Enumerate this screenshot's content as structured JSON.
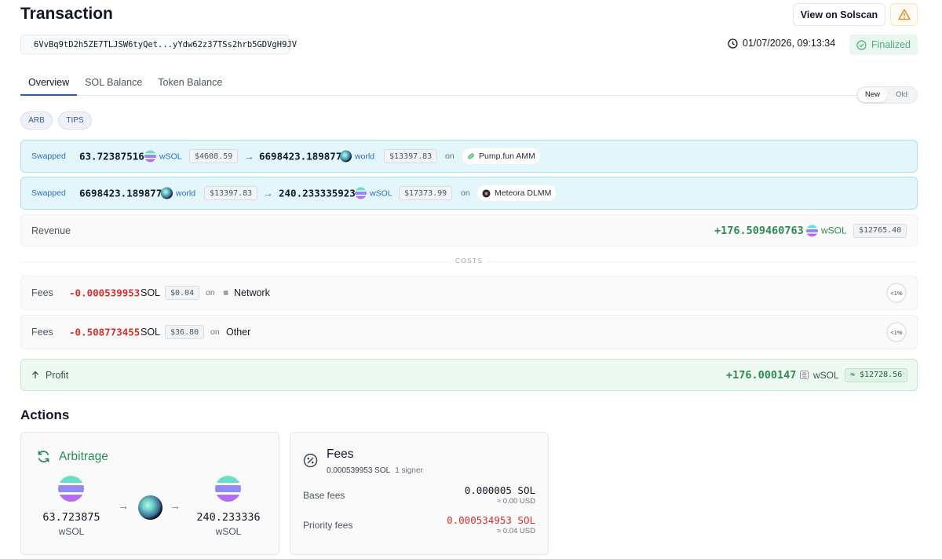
{
  "header": {
    "title": "Transaction",
    "view_button": "View on Solscan",
    "signature": "6VvBq9tD2h5ZE7TLJSW6tyQet...yYdw62z37TSs2hrb5GDVgH9JV",
    "timestamp": "01/07/2026, 09:13:34",
    "status": "Finalized"
  },
  "tabs": [
    "Overview",
    "SOL Balance",
    "Token Balance"
  ],
  "toggle": {
    "new": "New",
    "old": "Old"
  },
  "chips": [
    "ARB",
    "TIPS"
  ],
  "swaps": [
    {
      "label": "Swapped",
      "in_amount": "63.72387516",
      "in_token": "wSOL",
      "in_usd": "$4608.59",
      "arrow": "→",
      "out_amount": "6698423.189877",
      "out_token": "world",
      "out_usd": "$13397.83",
      "on": "on",
      "dex": "Pump.fun AMM"
    },
    {
      "label": "Swapped",
      "in_amount": "6698423.189877",
      "in_token": "world",
      "in_usd": "$13397.83",
      "arrow": "→",
      "out_amount": "240.233335923",
      "out_token": "wSOL",
      "out_usd": "$17373.99",
      "on": "on",
      "dex": "Meteora DLMM"
    }
  ],
  "revenue": {
    "label": "Revenue",
    "amount": "+176.509460763",
    "token": "wSOL",
    "usd": "$12765.40"
  },
  "costs_label": "COSTS",
  "fees": [
    {
      "label": "Fees",
      "amount": "-0.000539953",
      "token": "SOL",
      "usd": "$0.04",
      "on": "on",
      "target": "Network",
      "pct": "<1%"
    },
    {
      "label": "Fees",
      "amount": "-0.508773455",
      "token": "SOL",
      "usd": "$36.80",
      "on": "on",
      "target": "Other",
      "pct": "<1%"
    }
  ],
  "profit": {
    "label": "Profit",
    "amount": "+176.000147",
    "token": "wSOL",
    "usd": "≈ $12728.56"
  },
  "actions": {
    "title": "Actions",
    "arbitrage": {
      "title": "Arbitrage",
      "from_amount": "63.723875",
      "from_token": "wSOL",
      "to_amount": "240.233336",
      "to_token": "wSOL"
    },
    "fees": {
      "title": "Fees",
      "total": "0.000539953 SOL",
      "signers": "1 signer",
      "base_label": "Base fees",
      "base_value": "0.000005 SOL",
      "base_usd": "≈ 0.00 USD",
      "priority_label": "Priority fees",
      "priority_value": "0.000534953 SOL",
      "priority_usd": "≈ 0.04 USD"
    }
  },
  "colors": {
    "accent": "#2f5da8",
    "swap_bg": "#e3f7fb",
    "profit_bg": "#eef9f1",
    "positive": "#2f8a55",
    "negative": "#d0312d"
  }
}
